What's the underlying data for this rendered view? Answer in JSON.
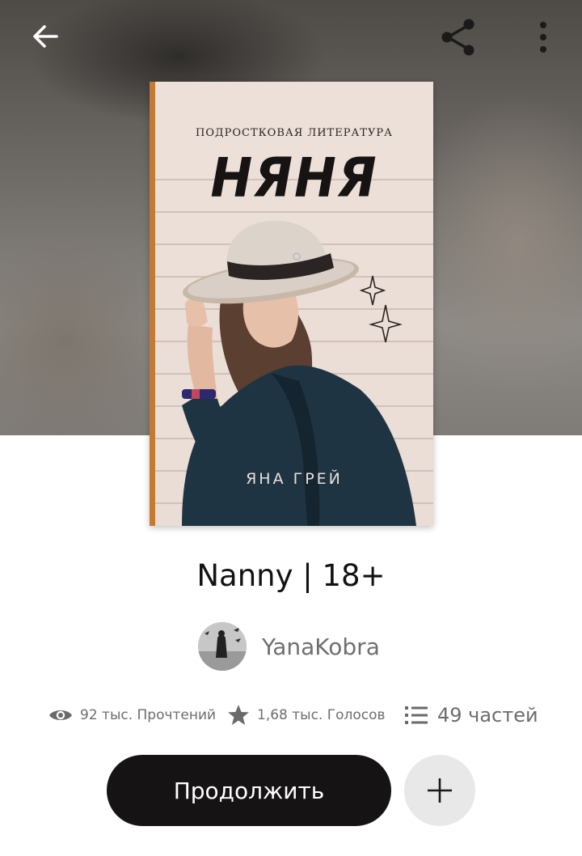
{
  "header": {
    "icons": [
      "arrow-left-icon",
      "share-icon",
      "more-vert-icon"
    ]
  },
  "cover": {
    "subtitle": "ПОДРОСТКОВАЯ ЛИТЕРАТУРА",
    "title": "НЯНЯ",
    "author": "ЯНА ГРЕЙ"
  },
  "book": {
    "title": "Nanny | 18+"
  },
  "author": {
    "name": "YanaKobra"
  },
  "stats": {
    "reads": "92 тыс. Прочтений",
    "votes": "1,68 тыс. Голосов",
    "parts": "49 частей"
  },
  "actions": {
    "continue_label": "Продолжить"
  },
  "colors": {
    "primary_button": "#151313",
    "secondary_button": "#e8e8e8",
    "cover_spine": "#c37b34"
  }
}
